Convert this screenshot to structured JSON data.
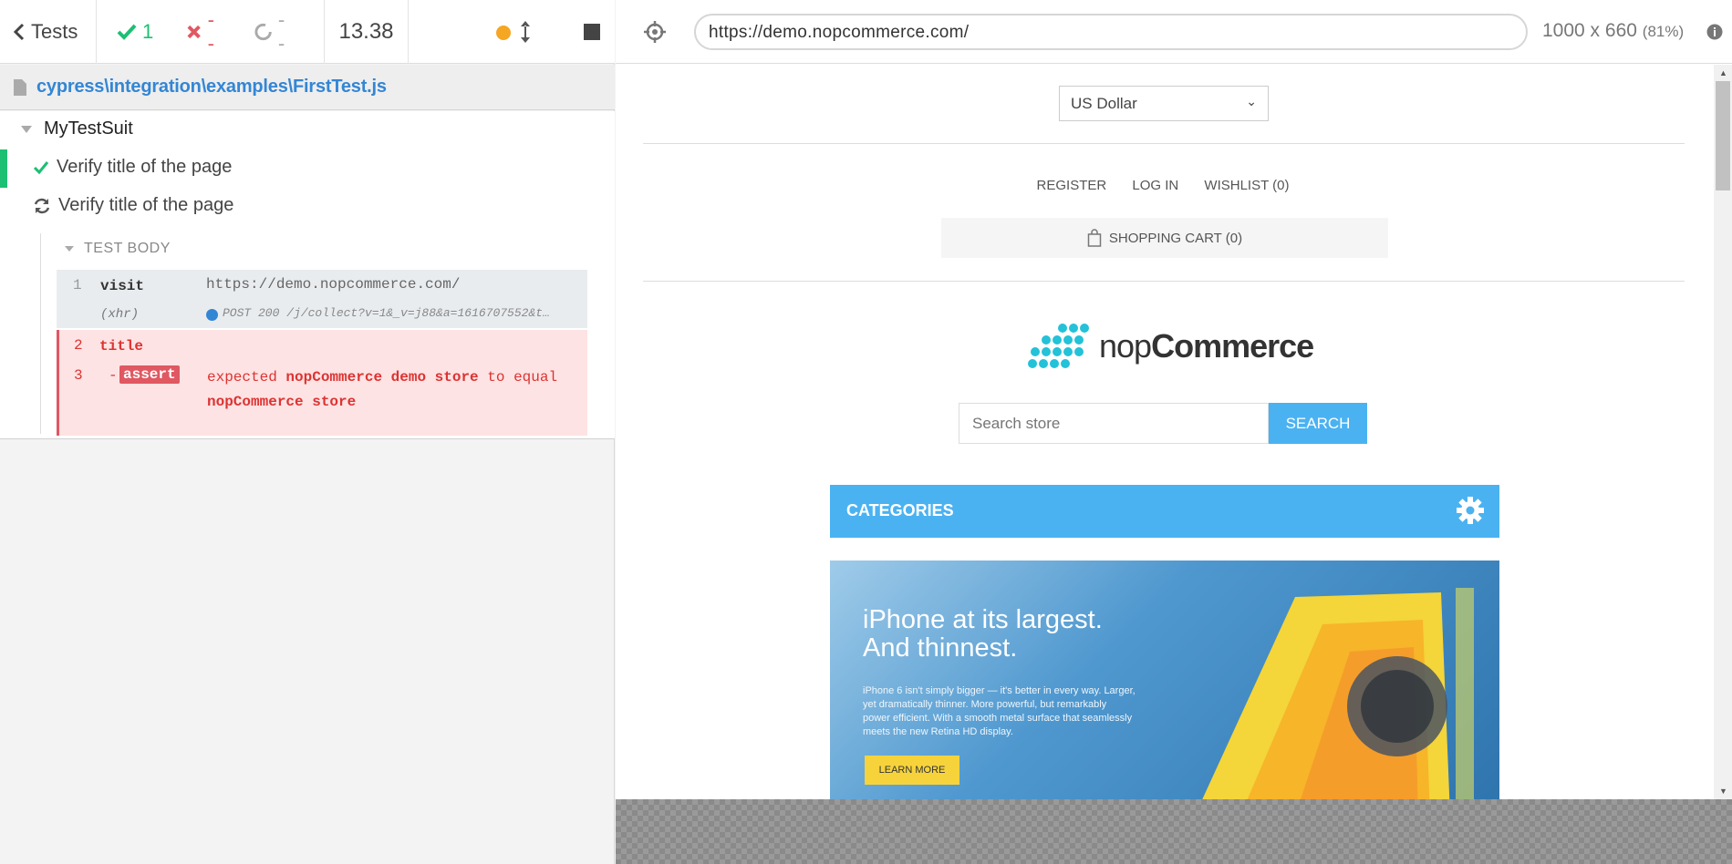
{
  "topbar": {
    "tests_label": "Tests",
    "passed": "1",
    "failed": "--",
    "pending": "--",
    "duration": "13.38"
  },
  "spec": {
    "path": "cypress\\integration\\examples\\FirstTest.js"
  },
  "runner": {
    "suite": "MyTestSuit",
    "tests": [
      {
        "title": "Verify title of the page",
        "state": "passed"
      },
      {
        "title": "Verify title of the page",
        "state": "running"
      }
    ],
    "test_body_label": "TEST BODY",
    "commands": [
      {
        "num": "1",
        "name": "visit",
        "message": "https://demo.nopcommerce.com/"
      },
      {
        "num": "",
        "name": "(xhr)",
        "message": "POST 200 /j/collect?v=1&_v=j88&a=1616707552&t…"
      },
      {
        "num": "2",
        "name": "title",
        "message": ""
      }
    ],
    "assert": {
      "num": "3",
      "prefix": "-",
      "badge": "assert",
      "text_1": "expected",
      "actual": "nopCommerce demo store",
      "text_2": "to equal",
      "expected": "nopCommerce store"
    }
  },
  "browser": {
    "url": "https://demo.nopcommerce.com/",
    "viewport": "1000 x 660",
    "zoom": "(81%)"
  },
  "site": {
    "currency": "US Dollar",
    "links": [
      "REGISTER",
      "LOG IN",
      "WISHLIST (0)"
    ],
    "cart": "SHOPPING CART (0)",
    "logo_light": "nop",
    "logo_bold": "Commerce",
    "search_placeholder": "Search store",
    "search_button": "SEARCH",
    "categories": "CATEGORIES",
    "banner": {
      "title_line1": "iPhone at its largest.",
      "title_line2": "And thinnest.",
      "copy": "iPhone 6 isn't simply bigger — it's better in every way. Larger, yet dramatically thinner. More powerful, but remarkably power efficient. With a smooth metal surface that seamlessly meets the new Retina HD display.",
      "button": "LEARN MORE"
    }
  },
  "colors": {
    "pass": "#1dbf73",
    "fail": "#e05861",
    "accent": "#4ab2f1",
    "link": "#3386d4"
  }
}
